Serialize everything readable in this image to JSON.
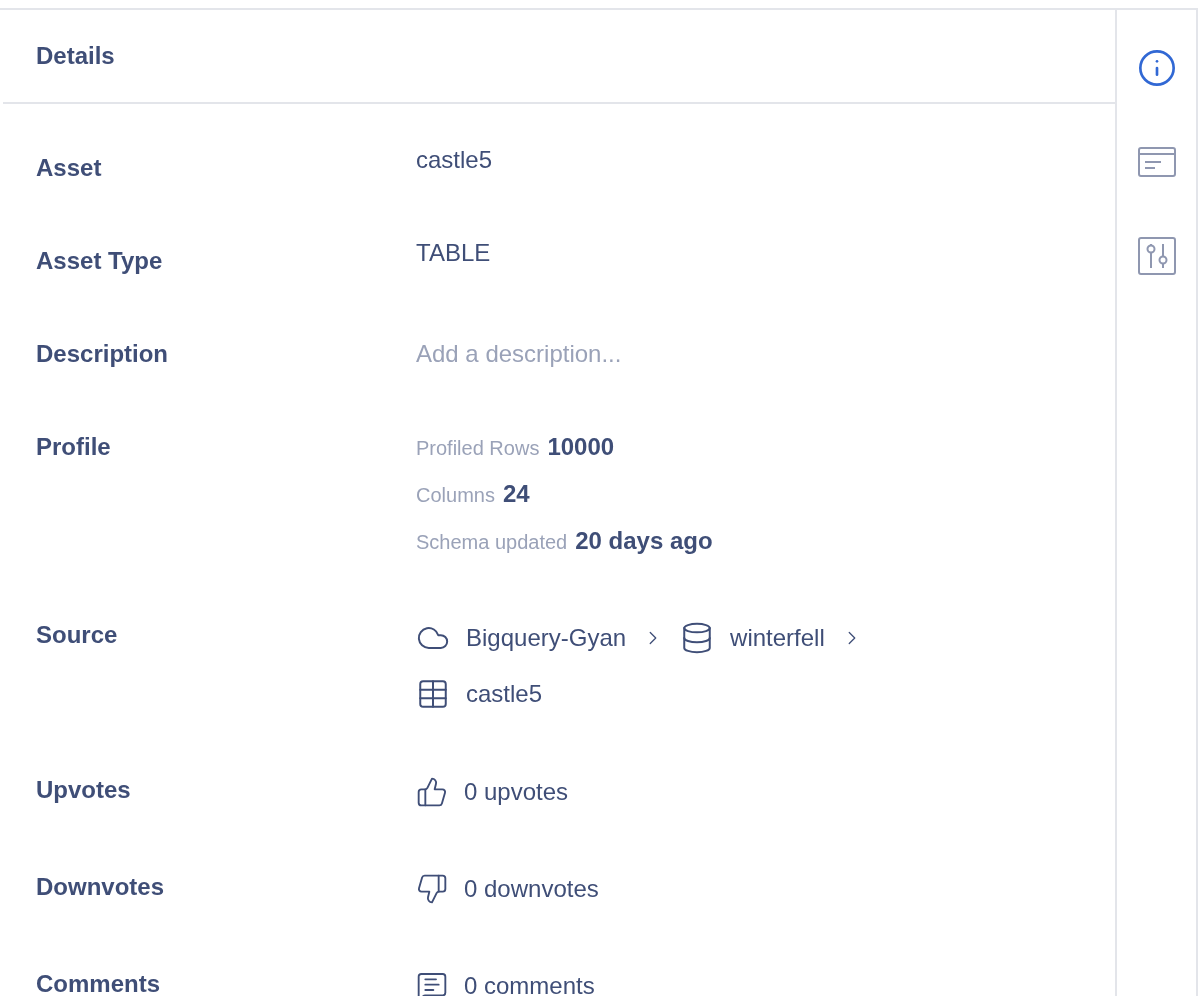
{
  "panel": {
    "title": "Details"
  },
  "rows": [
    {
      "kind": "text",
      "label": "Asset",
      "value": "castle5"
    },
    {
      "kind": "text",
      "label": "Asset Type",
      "value": "TABLE"
    },
    {
      "kind": "placeholder",
      "label": "Description",
      "placeholder": "Add a description..."
    },
    {
      "kind": "profile",
      "label": "Profile",
      "stats": [
        {
          "name": "Profiled Rows",
          "value": "10000"
        },
        {
          "name": "Columns",
          "value": "24"
        },
        {
          "name": "Schema updated",
          "value": "20 days ago"
        }
      ]
    },
    {
      "kind": "source",
      "label": "Source",
      "path": [
        "Bigquery-Gyan",
        "winterfell",
        "castle5"
      ]
    },
    {
      "kind": "upvotes",
      "label": "Upvotes",
      "value": "0 upvotes"
    },
    {
      "kind": "downvotes",
      "label": "Downvotes",
      "value": "0 downvotes"
    },
    {
      "kind": "comments",
      "label": "Comments",
      "value": "0 comments"
    }
  ],
  "rail": [
    {
      "selected": true
    },
    {
      "selected": false
    },
    {
      "selected": false
    }
  ]
}
